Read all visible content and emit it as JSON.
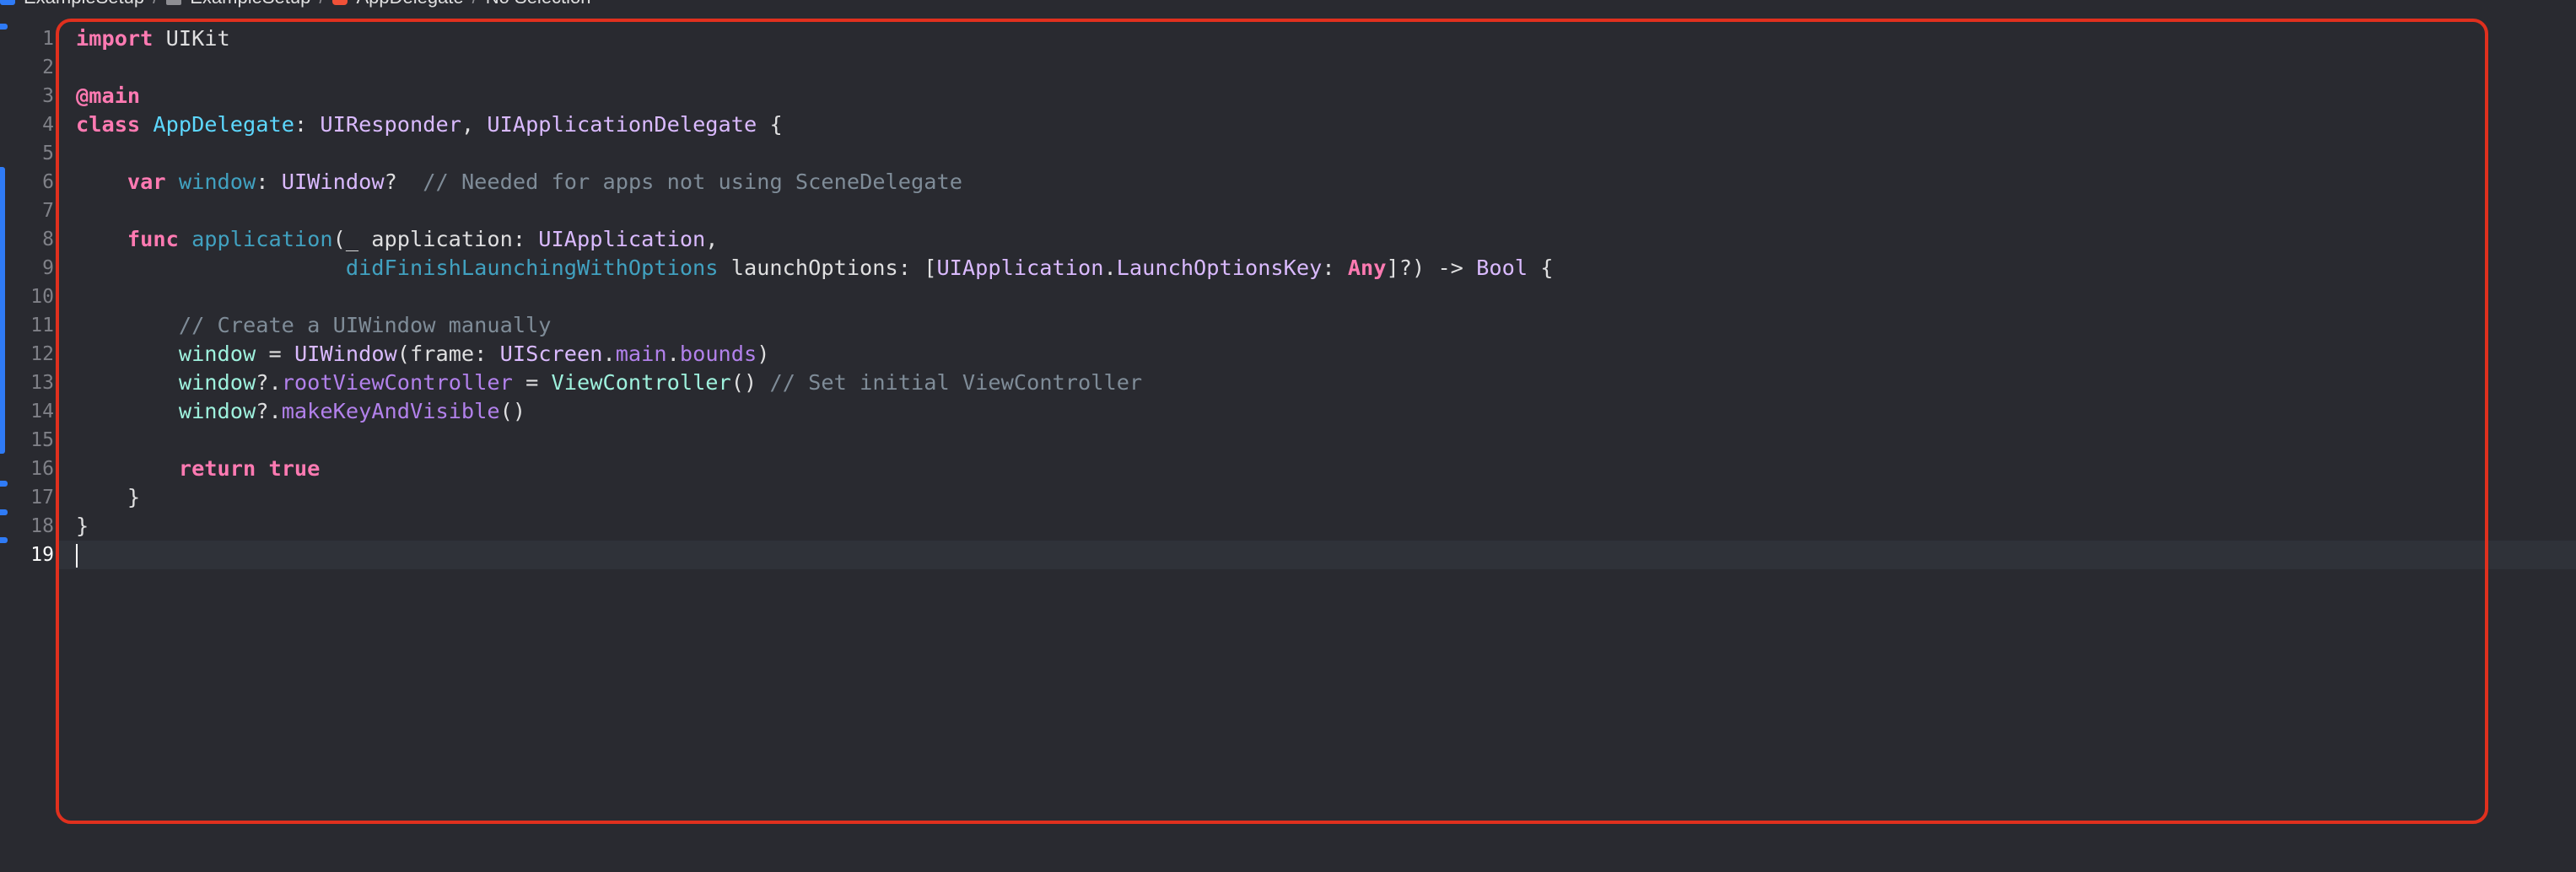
{
  "breadcrumb": {
    "project": "ExampleSetup",
    "group": "ExampleSetup",
    "file": "AppDelegate",
    "selection": "No Selection"
  },
  "editor": {
    "current_line": 19,
    "line_numbers": [
      "1",
      "2",
      "3",
      "4",
      "5",
      "6",
      "7",
      "8",
      "9",
      "10",
      "11",
      "12",
      "13",
      "14",
      "15",
      "16",
      "17",
      "18",
      "19"
    ],
    "lines": [
      [
        {
          "t": "import",
          "c": "kw"
        },
        {
          "t": " UIKit",
          "c": "plain"
        }
      ],
      [],
      [
        {
          "t": "@main",
          "c": "kw"
        }
      ],
      [
        {
          "t": "class",
          "c": "kw"
        },
        {
          "t": " ",
          "c": "plain"
        },
        {
          "t": "AppDelegate",
          "c": "cls"
        },
        {
          "t": ": ",
          "c": "plain"
        },
        {
          "t": "UIResponder",
          "c": "ty"
        },
        {
          "t": ", ",
          "c": "plain"
        },
        {
          "t": "UIApplicationDelegate",
          "c": "ty"
        },
        {
          "t": " {",
          "c": "plain"
        }
      ],
      [],
      [
        {
          "t": "    ",
          "c": "plain"
        },
        {
          "t": "var",
          "c": "kw"
        },
        {
          "t": " ",
          "c": "plain"
        },
        {
          "t": "window",
          "c": "fn"
        },
        {
          "t": ": ",
          "c": "plain"
        },
        {
          "t": "UIWindow",
          "c": "ty"
        },
        {
          "t": "?  ",
          "c": "plain"
        },
        {
          "t": "// Needed for apps not using SceneDelegate",
          "c": "cm"
        }
      ],
      [],
      [
        {
          "t": "    ",
          "c": "plain"
        },
        {
          "t": "func",
          "c": "kw"
        },
        {
          "t": " ",
          "c": "plain"
        },
        {
          "t": "application",
          "c": "fn"
        },
        {
          "t": "(_ application: ",
          "c": "plain"
        },
        {
          "t": "UIApplication",
          "c": "ty"
        },
        {
          "t": ",",
          "c": "plain"
        }
      ],
      [
        {
          "t": "                     ",
          "c": "plain"
        },
        {
          "t": "didFinishLaunchingWithOptions",
          "c": "fn"
        },
        {
          "t": " launchOptions: [",
          "c": "plain"
        },
        {
          "t": "UIApplication",
          "c": "ty"
        },
        {
          "t": ".",
          "c": "plain"
        },
        {
          "t": "LaunchOptionsKey",
          "c": "ty"
        },
        {
          "t": ": ",
          "c": "plain"
        },
        {
          "t": "Any",
          "c": "kw"
        },
        {
          "t": "]?) -> ",
          "c": "plain"
        },
        {
          "t": "Bool",
          "c": "ty"
        },
        {
          "t": " {",
          "c": "plain"
        }
      ],
      [],
      [
        {
          "t": "        ",
          "c": "plain"
        },
        {
          "t": "// Create a UIWindow manually",
          "c": "cm"
        }
      ],
      [
        {
          "t": "        ",
          "c": "plain"
        },
        {
          "t": "window",
          "c": "cust"
        },
        {
          "t": " = ",
          "c": "plain"
        },
        {
          "t": "UIWindow",
          "c": "ty"
        },
        {
          "t": "(frame: ",
          "c": "plain"
        },
        {
          "t": "UIScreen",
          "c": "ty"
        },
        {
          "t": ".",
          "c": "plain"
        },
        {
          "t": "main",
          "c": "prop"
        },
        {
          "t": ".",
          "c": "plain"
        },
        {
          "t": "bounds",
          "c": "prop"
        },
        {
          "t": ")",
          "c": "plain"
        }
      ],
      [
        {
          "t": "        ",
          "c": "plain"
        },
        {
          "t": "window",
          "c": "cust"
        },
        {
          "t": "?.",
          "c": "plain"
        },
        {
          "t": "rootViewController",
          "c": "prop"
        },
        {
          "t": " = ",
          "c": "plain"
        },
        {
          "t": "ViewController",
          "c": "cust"
        },
        {
          "t": "() ",
          "c": "plain"
        },
        {
          "t": "// Set initial ViewController",
          "c": "cm"
        }
      ],
      [
        {
          "t": "        ",
          "c": "plain"
        },
        {
          "t": "window",
          "c": "cust"
        },
        {
          "t": "?.",
          "c": "plain"
        },
        {
          "t": "makeKeyAndVisible",
          "c": "prop"
        },
        {
          "t": "()",
          "c": "plain"
        }
      ],
      [],
      [
        {
          "t": "        ",
          "c": "plain"
        },
        {
          "t": "return",
          "c": "kw"
        },
        {
          "t": " ",
          "c": "plain"
        },
        {
          "t": "true",
          "c": "kw"
        }
      ],
      [
        {
          "t": "    }",
          "c": "plain"
        }
      ],
      [
        {
          "t": "}",
          "c": "plain"
        }
      ],
      []
    ]
  },
  "colors": {
    "background": "#292a30",
    "current_line": "#2f3239",
    "highlight_border": "#e0301e",
    "change_marker": "#2f7bf6"
  }
}
